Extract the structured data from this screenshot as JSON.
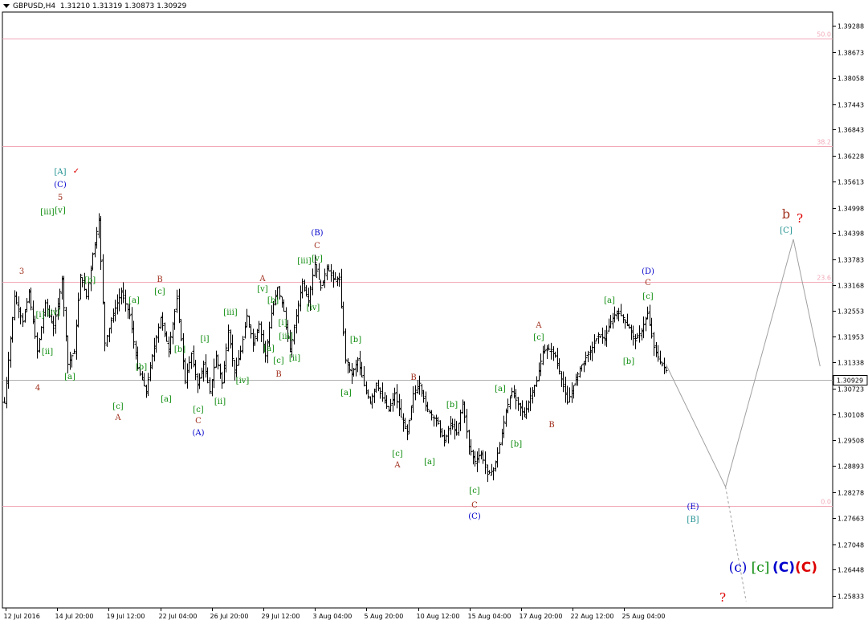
{
  "header": {
    "symbol": "GBPUSD,H4",
    "ohlc": "1.31210 1.31319 1.30873 1.30929"
  },
  "chart_data": {
    "type": "candlestick",
    "current_price": "1.30929",
    "ylim": [
      1.2554,
      1.3962
    ],
    "y_ticks": [
      "1.39288",
      "1.38673",
      "1.38058",
      "1.37443",
      "1.36843",
      "1.36228",
      "1.35613",
      "1.34998",
      "1.34398",
      "1.33783",
      "1.33168",
      "1.32553",
      "1.31953",
      "1.31338",
      "1.30723",
      "1.30108",
      "1.29508",
      "1.28893",
      "1.28278",
      "1.27663",
      "1.27048",
      "1.26448",
      "1.25833"
    ],
    "x_ticks": [
      "12 Jul 2016",
      "14 Jul 20:00",
      "19 Jul 12:00",
      "22 Jul 04:00",
      "26 Jul 20:00",
      "29 Jul 12:00",
      "3 Aug 04:00",
      "5 Aug 20:00",
      "10 Aug 12:00",
      "15 Aug 04:00",
      "17 Aug 20:00",
      "22 Aug 12:00",
      "25 Aug 04:00"
    ],
    "fib_levels": [
      {
        "label": "50.0",
        "price": 1.39
      },
      {
        "label": "38.2",
        "price": 1.3645
      },
      {
        "label": "23.6",
        "price": 1.3325
      },
      {
        "label": "0.0",
        "price": 1.2795
      }
    ],
    "price_path": [
      {
        "i": 0,
        "p": 1.304
      },
      {
        "i": 5,
        "p": 1.329
      },
      {
        "i": 9,
        "p": 1.323
      },
      {
        "i": 12,
        "p": 1.33
      },
      {
        "i": 16,
        "p": 1.316
      },
      {
        "i": 20,
        "p": 1.3275
      },
      {
        "i": 24,
        "p": 1.3215
      },
      {
        "i": 28,
        "p": 1.333
      },
      {
        "i": 31,
        "p": 1.313
      },
      {
        "i": 34,
        "p": 1.316
      },
      {
        "i": 37,
        "p": 1.334
      },
      {
        "i": 40,
        "p": 1.329
      },
      {
        "i": 43,
        "p": 1.339
      },
      {
        "i": 46,
        "p": 1.347
      },
      {
        "i": 49,
        "p": 1.318
      },
      {
        "i": 53,
        "p": 1.325
      },
      {
        "i": 57,
        "p": 1.33
      },
      {
        "i": 61,
        "p": 1.3245
      },
      {
        "i": 65,
        "p": 1.312
      },
      {
        "i": 69,
        "p": 1.3065
      },
      {
        "i": 72,
        "p": 1.315
      },
      {
        "i": 76,
        "p": 1.324
      },
      {
        "i": 80,
        "p": 1.3165
      },
      {
        "i": 84,
        "p": 1.3285
      },
      {
        "i": 88,
        "p": 1.309
      },
      {
        "i": 91,
        "p": 1.3155
      },
      {
        "i": 94,
        "p": 1.308
      },
      {
        "i": 97,
        "p": 1.313
      },
      {
        "i": 100,
        "p": 1.3065
      },
      {
        "i": 103,
        "p": 1.315
      },
      {
        "i": 106,
        "p": 1.3085
      },
      {
        "i": 109,
        "p": 1.321
      },
      {
        "i": 112,
        "p": 1.311
      },
      {
        "i": 115,
        "p": 1.316
      },
      {
        "i": 118,
        "p": 1.3245
      },
      {
        "i": 121,
        "p": 1.318
      },
      {
        "i": 124,
        "p": 1.3225
      },
      {
        "i": 127,
        "p": 1.315
      },
      {
        "i": 130,
        "p": 1.325
      },
      {
        "i": 133,
        "p": 1.331
      },
      {
        "i": 136,
        "p": 1.3255
      },
      {
        "i": 139,
        "p": 1.316
      },
      {
        "i": 142,
        "p": 1.3245
      },
      {
        "i": 145,
        "p": 1.3325
      },
      {
        "i": 148,
        "p": 1.328
      },
      {
        "i": 151,
        "p": 1.337
      },
      {
        "i": 154,
        "p": 1.331
      },
      {
        "i": 157,
        "p": 1.336
      },
      {
        "i": 160,
        "p": 1.333
      },
      {
        "i": 163,
        "p": 1.333
      },
      {
        "i": 166,
        "p": 1.314
      },
      {
        "i": 169,
        "p": 1.3105
      },
      {
        "i": 172,
        "p": 1.314
      },
      {
        "i": 175,
        "p": 1.308
      },
      {
        "i": 178,
        "p": 1.304
      },
      {
        "i": 181,
        "p": 1.3085
      },
      {
        "i": 184,
        "p": 1.305
      },
      {
        "i": 187,
        "p": 1.302
      },
      {
        "i": 190,
        "p": 1.306
      },
      {
        "i": 193,
        "p": 1.3005
      },
      {
        "i": 196,
        "p": 1.2965
      },
      {
        "i": 199,
        "p": 1.306
      },
      {
        "i": 202,
        "p": 1.3085
      },
      {
        "i": 205,
        "p": 1.303
      },
      {
        "i": 208,
        "p": 1.301
      },
      {
        "i": 211,
        "p": 1.299
      },
      {
        "i": 214,
        "p": 1.2945
      },
      {
        "i": 217,
        "p": 1.299
      },
      {
        "i": 220,
        "p": 1.2965
      },
      {
        "i": 223,
        "p": 1.304
      },
      {
        "i": 226,
        "p": 1.2935
      },
      {
        "i": 229,
        "p": 1.29
      },
      {
        "i": 232,
        "p": 1.292
      },
      {
        "i": 235,
        "p": 1.287
      },
      {
        "i": 238,
        "p": 1.288
      },
      {
        "i": 241,
        "p": 1.294
      },
      {
        "i": 244,
        "p": 1.302
      },
      {
        "i": 247,
        "p": 1.3065
      },
      {
        "i": 250,
        "p": 1.3035
      },
      {
        "i": 253,
        "p": 1.301
      },
      {
        "i": 256,
        "p": 1.3055
      },
      {
        "i": 259,
        "p": 1.309
      },
      {
        "i": 262,
        "p": 1.316
      },
      {
        "i": 265,
        "p": 1.3165
      },
      {
        "i": 268,
        "p": 1.315
      },
      {
        "i": 271,
        "p": 1.3095
      },
      {
        "i": 274,
        "p": 1.304
      },
      {
        "i": 277,
        "p": 1.308
      },
      {
        "i": 280,
        "p": 1.312
      },
      {
        "i": 283,
        "p": 1.3145
      },
      {
        "i": 286,
        "p": 1.317
      },
      {
        "i": 289,
        "p": 1.32
      },
      {
        "i": 292,
        "p": 1.319
      },
      {
        "i": 295,
        "p": 1.323
      },
      {
        "i": 298,
        "p": 1.3255
      },
      {
        "i": 301,
        "p": 1.324
      },
      {
        "i": 304,
        "p": 1.3215
      },
      {
        "i": 307,
        "p": 1.3185
      },
      {
        "i": 310,
        "p": 1.321
      },
      {
        "i": 313,
        "p": 1.325
      },
      {
        "i": 316,
        "p": 1.317
      },
      {
        "i": 319,
        "p": 1.3135
      },
      {
        "i": 322,
        "p": 1.3115
      }
    ],
    "projection": [
      {
        "i": 322,
        "p": 1.313
      },
      {
        "i": 351,
        "p": 1.284
      },
      {
        "i": 384,
        "p": 1.3425
      },
      {
        "i": 397,
        "p": 1.3125
      }
    ],
    "projection_dashed": [
      {
        "i": 351,
        "p": 1.284
      },
      {
        "i": 361,
        "p": 1.257
      }
    ],
    "annotations": [
      {
        "t": "[A]",
        "x": 75,
        "y": 213,
        "c": "#1e8f8f"
      },
      {
        "t": "✓",
        "x": 95,
        "y": 212,
        "c": "#dd0000"
      },
      {
        "t": "(C)",
        "x": 75,
        "y": 229,
        "c": "#0000cc"
      },
      {
        "t": "5",
        "x": 75,
        "y": 245,
        "c": "#a0301e"
      },
      {
        "t": "[iii]",
        "x": 59,
        "y": 263,
        "c": "#0a8a0a"
      },
      {
        "t": "[v]",
        "x": 75,
        "y": 261,
        "c": "#0a8a0a"
      },
      {
        "t": "3",
        "x": 27,
        "y": 337,
        "c": "#a0301e"
      },
      {
        "t": "[i]",
        "x": 50,
        "y": 391,
        "c": "#0a8a0a"
      },
      {
        "t": "[iv]",
        "x": 67,
        "y": 388,
        "c": "#0a8a0a"
      },
      {
        "t": "[ii]",
        "x": 59,
        "y": 437,
        "c": "#0a8a0a"
      },
      {
        "t": "4",
        "x": 47,
        "y": 482,
        "c": "#a0301e"
      },
      {
        "t": "[b]",
        "x": 112,
        "y": 348,
        "c": "#0a8a0a"
      },
      {
        "t": "[a]",
        "x": 87,
        "y": 468,
        "c": "#0a8a0a"
      },
      {
        "t": "[a]",
        "x": 167,
        "y": 373,
        "c": "#0a8a0a"
      },
      {
        "t": "[b]",
        "x": 176,
        "y": 456,
        "c": "#0a8a0a"
      },
      {
        "t": "[c]",
        "x": 147,
        "y": 505,
        "c": "#0a8a0a"
      },
      {
        "t": "A",
        "x": 147,
        "y": 519,
        "c": "#a0301e"
      },
      {
        "t": "B",
        "x": 199,
        "y": 347,
        "c": "#a0301e"
      },
      {
        "t": "[c]",
        "x": 199,
        "y": 362,
        "c": "#0a8a0a"
      },
      {
        "t": "[b]",
        "x": 224,
        "y": 434,
        "c": "#0a8a0a"
      },
      {
        "t": "[a]",
        "x": 207,
        "y": 496,
        "c": "#0a8a0a"
      },
      {
        "t": "[c]",
        "x": 247,
        "y": 509,
        "c": "#0a8a0a"
      },
      {
        "t": "C",
        "x": 247,
        "y": 523,
        "c": "#a0301e"
      },
      {
        "t": "(A)",
        "x": 247,
        "y": 538,
        "c": "#0000cc"
      },
      {
        "t": "[i]",
        "x": 255,
        "y": 421,
        "c": "#0a8a0a"
      },
      {
        "t": "[ii]",
        "x": 274,
        "y": 499,
        "c": "#0a8a0a"
      },
      {
        "t": "[iii]",
        "x": 287,
        "y": 388,
        "c": "#0a8a0a"
      },
      {
        "t": "[iv]",
        "x": 302,
        "y": 473,
        "c": "#0a8a0a"
      },
      {
        "t": "A",
        "x": 327,
        "y": 346,
        "c": "#a0301e"
      },
      {
        "t": "[v]",
        "x": 327,
        "y": 359,
        "c": "#0a8a0a"
      },
      {
        "t": "[b]",
        "x": 340,
        "y": 373,
        "c": "#0a8a0a"
      },
      {
        "t": "[i]",
        "x": 352,
        "y": 401,
        "c": "#0a8a0a"
      },
      {
        "t": "[a]",
        "x": 335,
        "y": 433,
        "c": "#0a8a0a"
      },
      {
        "t": "[iii]",
        "x": 356,
        "y": 418,
        "c": "#0a8a0a"
      },
      {
        "t": "[c]",
        "x": 347,
        "y": 448,
        "c": "#0a8a0a"
      },
      {
        "t": "[ii]",
        "x": 367,
        "y": 445,
        "c": "#0a8a0a"
      },
      {
        "t": "B",
        "x": 347,
        "y": 465,
        "c": "#a0301e"
      },
      {
        "t": "(B)",
        "x": 395,
        "y": 289,
        "c": "#0000cc"
      },
      {
        "t": "C",
        "x": 395,
        "y": 305,
        "c": "#a0301e"
      },
      {
        "t": "[iii]",
        "x": 379,
        "y": 324,
        "c": "#0a8a0a"
      },
      {
        "t": "[v]",
        "x": 395,
        "y": 321,
        "c": "#0a8a0a"
      },
      {
        "t": "[iv]",
        "x": 390,
        "y": 382,
        "c": "#0a8a0a"
      },
      {
        "t": "[b]",
        "x": 443,
        "y": 422,
        "c": "#0a8a0a"
      },
      {
        "t": "[a]",
        "x": 431,
        "y": 488,
        "c": "#0a8a0a"
      },
      {
        "t": "B",
        "x": 515,
        "y": 469,
        "c": "#a0301e"
      },
      {
        "t": "[c]",
        "x": 495,
        "y": 564,
        "c": "#0a8a0a"
      },
      {
        "t": "A",
        "x": 495,
        "y": 578,
        "c": "#a0301e"
      },
      {
        "t": "[b]",
        "x": 563,
        "y": 503,
        "c": "#0a8a0a"
      },
      {
        "t": "[a]",
        "x": 535,
        "y": 574,
        "c": "#0a8a0a"
      },
      {
        "t": "[c]",
        "x": 591,
        "y": 610,
        "c": "#0a8a0a"
      },
      {
        "t": "C",
        "x": 591,
        "y": 628,
        "c": "#a0301e"
      },
      {
        "t": "(C)",
        "x": 591,
        "y": 642,
        "c": "#0000cc"
      },
      {
        "t": "[a]",
        "x": 623,
        "y": 483,
        "c": "#0a8a0a"
      },
      {
        "t": "[b]",
        "x": 643,
        "y": 552,
        "c": "#0a8a0a"
      },
      {
        "t": "A",
        "x": 671,
        "y": 404,
        "c": "#a0301e"
      },
      {
        "t": "[c]",
        "x": 671,
        "y": 419,
        "c": "#0a8a0a"
      },
      {
        "t": "B",
        "x": 687,
        "y": 528,
        "c": "#a0301e"
      },
      {
        "t": "[a]",
        "x": 759,
        "y": 373,
        "c": "#0a8a0a"
      },
      {
        "t": "[b]",
        "x": 783,
        "y": 449,
        "c": "#0a8a0a"
      },
      {
        "t": "(D)",
        "x": 807,
        "y": 337,
        "c": "#0000cc"
      },
      {
        "t": "C",
        "x": 807,
        "y": 351,
        "c": "#a0301e"
      },
      {
        "t": "[c]",
        "x": 807,
        "y": 368,
        "c": "#0a8a0a"
      },
      {
        "t": "(E)",
        "x": 863,
        "y": 630,
        "c": "#0000cc"
      },
      {
        "t": "[B]",
        "x": 863,
        "y": 646,
        "c": "#1e8f8f"
      },
      {
        "t": "b",
        "x": 979,
        "y": 268,
        "c": "#a0301e",
        "s": 16
      },
      {
        "t": "?",
        "x": 996,
        "y": 273,
        "c": "#dd0000",
        "s": 15
      },
      {
        "t": "[C]",
        "x": 979,
        "y": 286,
        "c": "#1e8f8f"
      },
      {
        "t": "?",
        "x": 900,
        "y": 745,
        "c": "#dd0000",
        "s": 15
      }
    ],
    "legend": [
      {
        "t": "(c)",
        "c": "#0000cc",
        "x": 919,
        "w": "normal"
      },
      {
        "t": "[c]",
        "c": "#0a8a0a",
        "x": 947,
        "w": "normal"
      },
      {
        "t": "(C)",
        "c": "#0000cc",
        "x": 976,
        "w": "bold"
      },
      {
        "t": "(C)",
        "c": "#dd0000",
        "x": 1004,
        "w": "bold"
      }
    ]
  }
}
